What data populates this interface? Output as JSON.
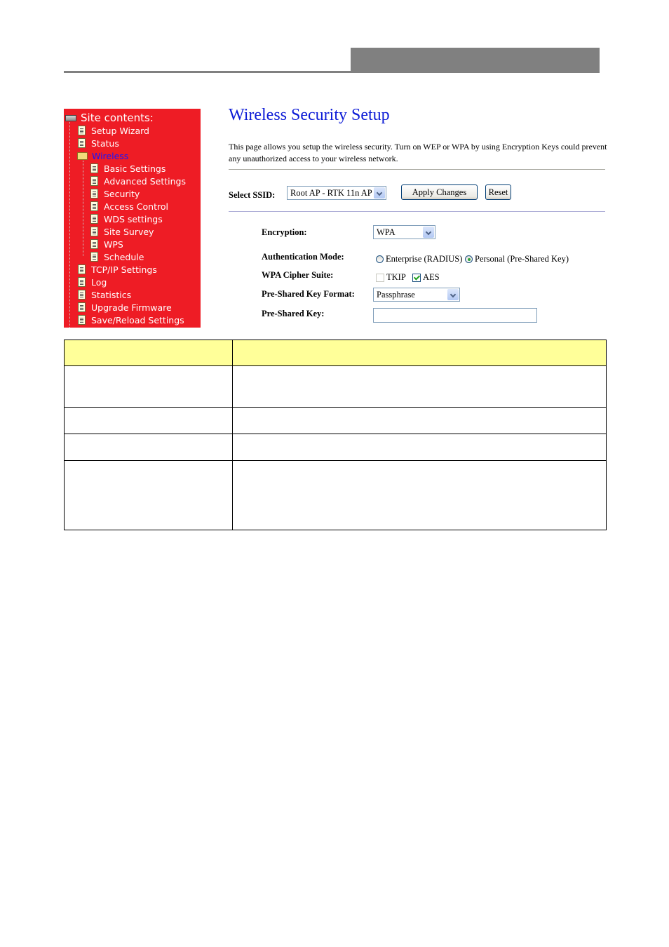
{
  "header": {
    "bar_color": "#808080"
  },
  "sidebar": {
    "background": "#ee1c25",
    "root_label": "Site contents:",
    "items": [
      {
        "label": "Setup Wizard",
        "level": 1,
        "icon": "document-icon"
      },
      {
        "label": "Status",
        "level": 1,
        "icon": "document-icon"
      },
      {
        "label": "Wireless",
        "level": 1,
        "icon": "folder-open-icon",
        "active": true
      },
      {
        "label": "Basic Settings",
        "level": 2,
        "icon": "document-icon"
      },
      {
        "label": "Advanced Settings",
        "level": 2,
        "icon": "document-icon"
      },
      {
        "label": "Security",
        "level": 2,
        "icon": "document-icon"
      },
      {
        "label": "Access Control",
        "level": 2,
        "icon": "document-icon"
      },
      {
        "label": "WDS settings",
        "level": 2,
        "icon": "document-icon"
      },
      {
        "label": "Site Survey",
        "level": 2,
        "icon": "document-icon"
      },
      {
        "label": "WPS",
        "level": 2,
        "icon": "document-icon"
      },
      {
        "label": "Schedule",
        "level": 2,
        "icon": "document-icon"
      },
      {
        "label": "TCP/IP Settings",
        "level": 1,
        "icon": "document-icon"
      },
      {
        "label": "Log",
        "level": 1,
        "icon": "document-icon"
      },
      {
        "label": "Statistics",
        "level": 1,
        "icon": "document-icon"
      },
      {
        "label": "Upgrade Firmware",
        "level": 1,
        "icon": "document-icon"
      },
      {
        "label": "Save/Reload Settings",
        "level": 1,
        "icon": "document-icon"
      }
    ]
  },
  "main": {
    "title": "Wireless Security Setup",
    "title_color": "#0c1bd6",
    "description": "This page allows you setup the wireless security. Turn on WEP or WPA by using Encryption Keys could prevent any unauthorized access to your wireless network.",
    "ssid": {
      "label": "Select SSID:",
      "value": "Root AP - RTK 11n AP"
    },
    "apply_button": "Apply Changes",
    "reset_button": "Reset",
    "encryption": {
      "label": "Encryption:",
      "value": "WPA"
    },
    "auth_mode": {
      "label": "Authentication Mode:",
      "options": [
        {
          "label": "Enterprise (RADIUS)",
          "selected": false
        },
        {
          "label": "Personal (Pre-Shared Key)",
          "selected": true
        }
      ]
    },
    "cipher_suite": {
      "label": "WPA Cipher Suite:",
      "options": [
        {
          "label": "TKIP",
          "checked": false
        },
        {
          "label": "AES",
          "checked": true
        }
      ]
    },
    "psk_format": {
      "label": "Pre-Shared Key Format:",
      "value": "Passphrase"
    },
    "psk": {
      "label": "Pre-Shared Key:",
      "value": ""
    }
  },
  "table": {
    "header_color": "#ffff99",
    "headers": [
      "",
      ""
    ],
    "rows": [
      [
        "",
        ""
      ],
      [
        "",
        ""
      ],
      [
        "",
        ""
      ],
      [
        "",
        ""
      ]
    ]
  }
}
